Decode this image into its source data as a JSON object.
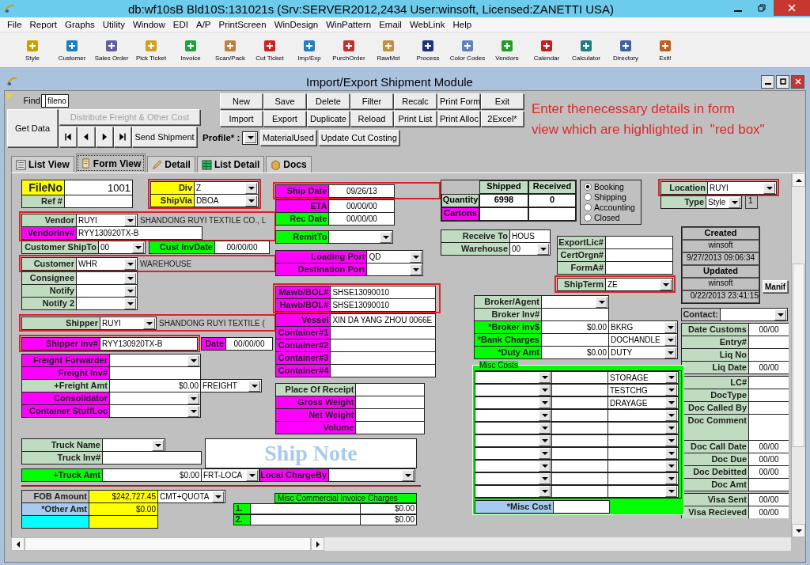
{
  "window": {
    "title": "db:wf10sB Bld10S:131021s (Srv:SERVER2012,2434 User:winsoft, Licensed:ZANETTI USA)"
  },
  "menu": [
    "File",
    "Report",
    "Graphs",
    "Utility",
    "Window",
    "EDI",
    "A/P",
    "PrintScreen",
    "WinDesign",
    "WinPattern",
    "Email",
    "WebLink",
    "Help"
  ],
  "toolbar": [
    "Style",
    "Customer",
    "Sales Order",
    "Pick Ticket",
    "Invoice",
    "Scan/Pack",
    "Cut Ticket",
    "Imp/Exp",
    "PurchOrder",
    "RawMst",
    "Process",
    "Color Codes",
    "Vendors",
    "Calendar",
    "Calculator",
    "Directory",
    "Exit!"
  ],
  "module": {
    "title": "Import/Export Shipment Module"
  },
  "top": {
    "find_label": "Find",
    "key_field": "fileno",
    "get_data": "Get Data",
    "distribute": {
      "label": "Distribute Freight & Other Cost",
      "disabled": true
    },
    "send": "Send Shipment",
    "buttons": [
      [
        "New",
        "Save",
        "Delete",
        "Filter",
        "Recalc",
        "Print Form",
        "Exit"
      ],
      [
        "Import",
        "Export",
        "Duplicate",
        "Reload",
        "Print List",
        "Print Alloc",
        "2Excel*"
      ]
    ],
    "profile_label": "Profile* :",
    "material": "MaterialUsed",
    "update": "Update Cut Costing"
  },
  "note": [
    "Enter thenecessary details in form",
    "view which are highlighted in  \"red box\""
  ],
  "tabs": [
    {
      "label": "List View",
      "selected": false
    },
    {
      "label": "Form View",
      "selected": true
    },
    {
      "label": "Detail",
      "selected": false
    },
    {
      "label": "List Detail",
      "selected": false
    },
    {
      "label": "Docs",
      "selected": false
    }
  ],
  "form": {
    "fileno": {
      "fields": [
        {
          "label": "FileNo",
          "color": "#ffff00",
          "kind": "number",
          "value": "1001"
        },
        {
          "label": "Ref #",
          "color": "#c0dcc0",
          "kind": "text"
        }
      ]
    },
    "div": {
      "highlighted": true,
      "fields": [
        {
          "label": "Div",
          "color": "#ffff00",
          "kind": "combo",
          "value": "Z"
        },
        {
          "label": "ShipVia",
          "color": "#ffff00",
          "kind": "combo",
          "value": "DBOA"
        }
      ]
    },
    "vendor": {
      "highlighted": true,
      "fields": [
        {
          "label": "Vendor",
          "color": "#c0dcc0",
          "kind": "combo",
          "value": "RUYI",
          "note": "SHANDONG RUYI TEXTILE CO., L"
        },
        {
          "label": "VendorInv#",
          "color": "#ff00ff",
          "kind": "text",
          "value": "RYY130920TX-B"
        }
      ]
    },
    "ship_to": {
      "fields": [
        {
          "label": "Customer ShipTo",
          "color": "#c0dcc0",
          "kind": "combo",
          "value": "00"
        }
      ]
    },
    "cust_inv_date": {
      "fields": [
        {
          "label": "Cust InvDate",
          "color": "#00ff00",
          "kind": "date",
          "value": "00/00/00"
        }
      ]
    },
    "customer": {
      "highlighted": true,
      "fields": [
        {
          "label": "Customer",
          "color": "#c0dcc0",
          "kind": "combo",
          "value": "WHR",
          "note": "WAREHOUSE"
        }
      ]
    },
    "parties": {
      "fields": [
        {
          "label": "Consignee",
          "color": "#c0dcc0",
          "kind": "combo"
        },
        {
          "label": "Notify",
          "color": "#c0dcc0",
          "kind": "combo"
        },
        {
          "label": "Notify 2",
          "color": "#c0dcc0",
          "kind": "combo"
        }
      ]
    },
    "shipper": {
      "highlighted": true,
      "fields": [
        {
          "label": "Shipper",
          "color": "#c0dcc0",
          "kind": "combo",
          "value": "RUYI",
          "note": "SHANDONG RUYI TEXTILE ("
        }
      ]
    },
    "shipper_inv": {
      "highlighted": true,
      "fields": [
        {
          "label": "Shipper Inv#",
          "color": "#ff00ff",
          "kind": "text",
          "value": "RYY130920TX-B"
        }
      ]
    },
    "shipper_inv_date": {
      "fields": [
        {
          "label": "Date",
          "color": "#ff00ff",
          "kind": "date",
          "value": "00/00/00"
        }
      ]
    },
    "freight": {
      "fields": [
        {
          "label": "Freight Forwarder",
          "color": "#ff00ff",
          "kind": "combo"
        },
        {
          "label": "Freight Inv#",
          "color": "#ff00ff",
          "kind": "text"
        },
        {
          "label": "+Freight Amt",
          "color": "#c0dcc0",
          "kind": "amount_combo",
          "value": "$0.00",
          "option": "FREIGHT"
        },
        {
          "label": "Consolidator",
          "color": "#ff00ff",
          "kind": "combo"
        },
        {
          "label": "Container StuffLoc",
          "color": "#ff00ff",
          "kind": "combo"
        }
      ]
    },
    "ship_date": {
      "highlighted": true,
      "fields": [
        {
          "label": "Ship Date",
          "color": "#ff00ff",
          "kind": "date",
          "value": "09/26/13"
        }
      ]
    },
    "dates": {
      "fields": [
        {
          "label": "ETA",
          "color": "#ff00ff",
          "kind": "date",
          "value": "00/00/00"
        },
        {
          "label": "Rec Date",
          "color": "#00ff00",
          "kind": "date",
          "value": "00/00/00"
        }
      ]
    },
    "remit": {
      "fields": [
        {
          "label": "RemitTo",
          "color": "#00ff00",
          "kind": "combo"
        }
      ]
    },
    "ports": {
      "fields": [
        {
          "label": "Loading Port",
          "color": "#ff00ff",
          "kind": "combo",
          "value": "QD"
        },
        {
          "label": "Destination Port",
          "color": "#ff00ff",
          "kind": "combo"
        }
      ]
    },
    "bol": {
      "highlighted": true,
      "fields": [
        {
          "label": "Mawb/BOL#",
          "color": "#ff00ff",
          "kind": "text",
          "value": "SHSE13090010"
        },
        {
          "label": "Hawb/BOL#",
          "color": "#ff00ff",
          "kind": "text",
          "value": "SHSE13090010"
        }
      ]
    },
    "vessel": {
      "fields": [
        {
          "label": "Vessel",
          "color": "#ff00ff",
          "kind": "text",
          "value": "XIN DA YANG ZHOU 0066E"
        },
        {
          "label": "Container#1",
          "color": "#ff00ff",
          "kind": "text"
        },
        {
          "label": "Container#2",
          "color": "#ff00ff",
          "kind": "text"
        },
        {
          "label": "Container#3",
          "color": "#ff00ff",
          "kind": "text"
        },
        {
          "label": "Container#4",
          "color": "#ff00ff",
          "kind": "text"
        }
      ]
    },
    "receipt": {
      "fields": [
        {
          "label": "Place Of Receipt",
          "color": "#c0dcc0",
          "kind": "text"
        },
        {
          "label": "Gross Weight",
          "color": "#ff00ff",
          "kind": "text"
        },
        {
          "label": "Net Weight",
          "color": "#ff00ff",
          "kind": "text"
        },
        {
          "label": "Volume",
          "color": "#ff00ff",
          "kind": "text"
        }
      ]
    },
    "truck": {
      "fields": [
        {
          "label": "Truck Name",
          "color": "#c0dcc0",
          "kind": "combo"
        },
        {
          "label": "Truck Inv#",
          "color": "#c0dcc0",
          "kind": "text"
        }
      ]
    },
    "truck_amt": {
      "fields": [
        {
          "label": "+Truck Amt",
          "color": "#00ff00",
          "kind": "amount_combo",
          "value": "$0.00",
          "option": "FRT-LOCA"
        }
      ]
    },
    "ship_note": "Ship Note",
    "local_charge": {
      "fields": [
        {
          "label": "Local ChargeBy",
          "color": "#ff00ff",
          "kind": "combo"
        }
      ]
    },
    "fob": {
      "fields": [
        {
          "label": "FOB Amount",
          "color": "#c0c0c0",
          "kind": "amount_combo",
          "value": "$242,727.45",
          "option": "CMT+QUOTA"
        },
        {
          "label": "*Other Amt",
          "color": "#a6caf0",
          "kind": "amount",
          "value": "$0.00"
        },
        {
          "color": "#00ffff",
          "kind": "amount"
        }
      ]
    },
    "misc_invoice": {
      "title": "Misc Commercial Invoice Charges",
      "rows": [
        {
          "number": "1.",
          "amount": "$0.00"
        },
        {
          "number": "2.",
          "amount": "$0.00"
        }
      ]
    },
    "quantity": {
      "columns": [
        "Shipped",
        "Received"
      ],
      "rows": [
        {
          "label": "Quantity",
          "color": "#c0dcc0",
          "values": [
            "6998",
            "0"
          ]
        },
        {
          "label": "Cartons",
          "color": "#ff00ff"
        }
      ]
    },
    "status": [
      {
        "label": "Booking",
        "selected": true
      },
      {
        "label": "Shipping",
        "selected": false
      },
      {
        "label": "Accounting",
        "selected": false
      },
      {
        "label": "Closed",
        "selected": false
      }
    ],
    "location": {
      "highlighted": true,
      "fields": [
        {
          "label": "Location",
          "color": "#c0dcc0",
          "kind": "combo",
          "value": "RUYI"
        }
      ]
    },
    "type": {
      "fields": [
        {
          "label": "Type",
          "color": "#c0dcc0",
          "kind": "combo",
          "value": "Style"
        }
      ]
    },
    "count": "1",
    "receive": {
      "fields": [
        {
          "label": "Receive To",
          "color": "#c0dcc0",
          "kind": "text",
          "value": "HOUS"
        },
        {
          "label": "Warehouse",
          "color": "#c0dcc0",
          "kind": "combo",
          "value": "00"
        }
      ]
    },
    "export": {
      "fields": [
        {
          "label": "ExportLic#",
          "color": "#c0dcc0",
          "kind": "text"
        },
        {
          "label": "CertOrgn#",
          "color": "#c0dcc0",
          "kind": "text"
        },
        {
          "label": "FormA#",
          "color": "#c0dcc0",
          "kind": "text"
        }
      ]
    },
    "ship_term": {
      "highlighted": true,
      "fields": [
        {
          "label": "ShipTerm",
          "color": "#c0dcc0",
          "kind": "combo",
          "value": "ZE"
        }
      ]
    },
    "audit": {
      "created_label": "Created",
      "created_by": "winsoft",
      "created_at": "9/27/2013 09:06:34",
      "updated_label": "Updated",
      "updated_by": "winsoft",
      "updated_at": "0/22/2013 23:41:15"
    },
    "manifest_button": "Manif",
    "contact": {
      "fields": [
        {
          "label": "Contact:",
          "color": "#c0c0c0",
          "kind": "combo"
        }
      ]
    },
    "customs": {
      "fields": [
        {
          "label": "Date Customs",
          "color": "#c0dcc0",
          "kind": "date",
          "value": "00/00"
        },
        {
          "label": "Entry#",
          "color": "#c0dcc0",
          "kind": "text"
        },
        {
          "label": "Liq No",
          "color": "#c0dcc0",
          "kind": "text"
        },
        {
          "label": "Liq Date",
          "color": "#c0dcc0",
          "kind": "date",
          "value": "00/00"
        }
      ]
    },
    "docs": {
      "fields": [
        {
          "label": "LC#",
          "color": "#c0dcc0",
          "kind": "text"
        },
        {
          "label": "DocType",
          "color": "#c0dcc0",
          "kind": "text"
        },
        {
          "label": "Doc Called By",
          "color": "#c0dcc0",
          "kind": "text"
        },
        {
          "label": "Doc Comment",
          "color": "#c0dcc0",
          "kind": "memo"
        },
        {
          "label": "Doc Call Date",
          "color": "#c0dcc0",
          "kind": "date",
          "value": "00/00"
        },
        {
          "label": "Doc Due",
          "color": "#c0dcc0",
          "kind": "date",
          "value": "00/00"
        },
        {
          "label": "Doc Debitted",
          "color": "#c0dcc0",
          "kind": "date",
          "value": "00/00"
        },
        {
          "label": "Doc Amt",
          "color": "#c0dcc0",
          "kind": "text"
        }
      ]
    },
    "visa": {
      "fields": [
        {
          "label": "Visa Sent",
          "color": "#c0dcc0",
          "kind": "date",
          "value": "00/00"
        },
        {
          "label": "Visa Recieved",
          "color": "#c0dcc0",
          "kind": "date",
          "value": "00/00"
        }
      ]
    },
    "broker": {
      "fields": [
        {
          "label": "Broker/Agent",
          "color": "#c0dcc0",
          "kind": "combo"
        },
        {
          "label": "Broker Inv#",
          "color": "#c0dcc0",
          "kind": "text"
        },
        {
          "label": "*Broker Inv$",
          "color": "#00ff00",
          "kind": "amount_combo",
          "value": "$0.00",
          "option": "BKRG"
        },
        {
          "label": "*Bank Charges",
          "color": "#00ff00",
          "kind": "amount_combo",
          "option": "DOCHANDLE"
        },
        {
          "label": "*Duty Amt",
          "color": "#00ff00",
          "kind": "amount_combo",
          "value": "$0.00",
          "option": "DUTY"
        }
      ]
    },
    "misc_costs": {
      "title": "Misc Costs",
      "rows": [
        {
          "code": "STORAGE"
        },
        {
          "code": "TESTCHG"
        },
        {
          "code": "DRAYAGE"
        },
        {},
        {},
        {},
        {},
        {},
        {},
        {}
      ],
      "total": {
        "fields": [
          {
            "label": "*Misc Cost",
            "color": "#a6caf0",
            "kind": "text"
          }
        ]
      }
    }
  }
}
